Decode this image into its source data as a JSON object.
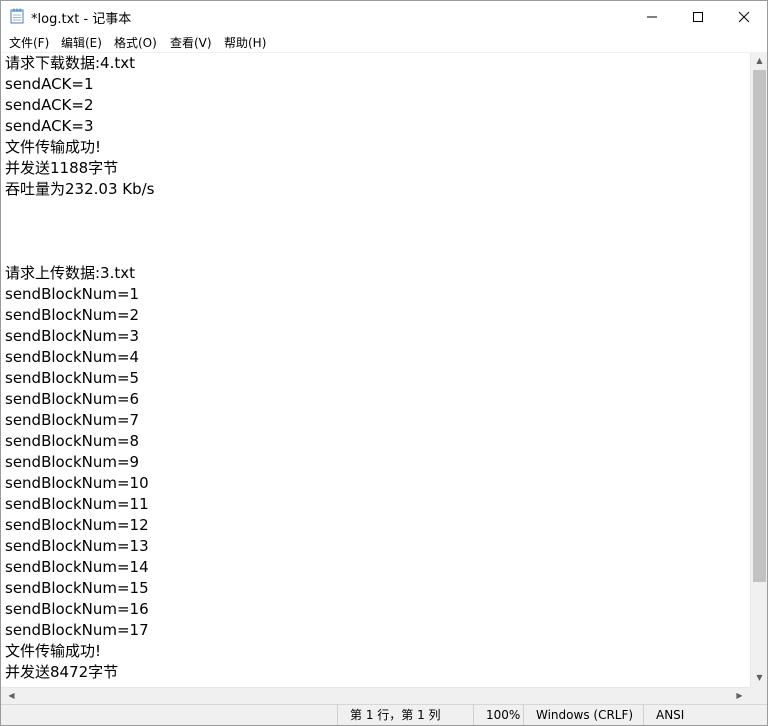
{
  "window": {
    "title": "*log.txt - 记事本"
  },
  "menu": [
    {
      "label": "文件(F)"
    },
    {
      "label": "编辑(E)"
    },
    {
      "label": "格式(O)"
    },
    {
      "label": "查看(V)"
    },
    {
      "label": "帮助(H)"
    }
  ],
  "content": {
    "lines": [
      "请求下载数据:4.txt",
      "sendACK=1",
      "sendACK=2",
      "sendACK=3",
      "文件传输成功!",
      "并发送1188字节",
      "吞吐量为232.03 Kb/s",
      "",
      "",
      "",
      "请求上传数据:3.txt",
      "sendBlockNum=1",
      "sendBlockNum=2",
      "sendBlockNum=3",
      "sendBlockNum=4",
      "sendBlockNum=5",
      "sendBlockNum=6",
      "sendBlockNum=7",
      "sendBlockNum=8",
      "sendBlockNum=9",
      "sendBlockNum=10",
      "sendBlockNum=11",
      "sendBlockNum=12",
      "sendBlockNum=13",
      "sendBlockNum=14",
      "sendBlockNum=15",
      "sendBlockNum=16",
      "sendBlockNum=17",
      "文件传输成功!",
      "并发送8472字节"
    ]
  },
  "status": {
    "position": "第 1 行，第 1 列",
    "zoom": "100%",
    "line_ending": "Windows (CRLF)",
    "encoding": "ANSI"
  },
  "icons": {
    "app": "notepad-icon",
    "minimize": "minimize-icon",
    "maximize": "maximize-icon",
    "close": "close-icon"
  }
}
